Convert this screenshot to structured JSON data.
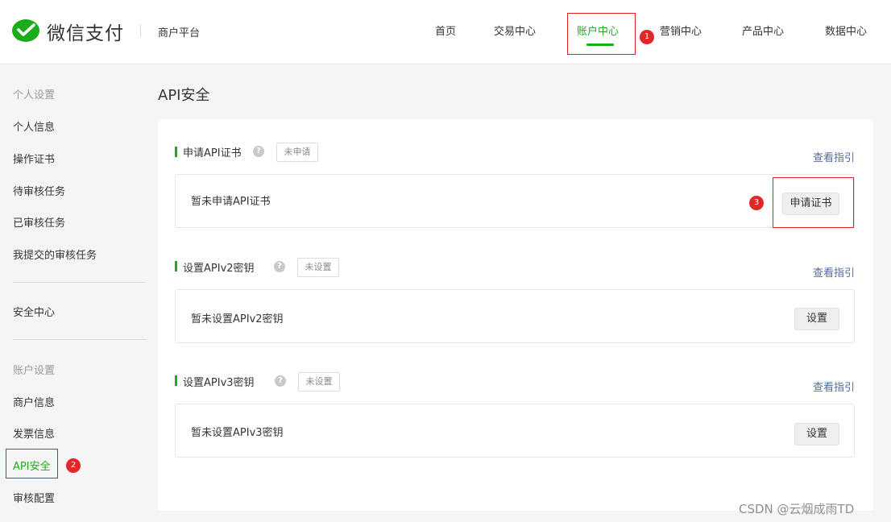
{
  "header": {
    "brand_name": "微信支付",
    "platform_name": "商户平台",
    "nav": [
      {
        "label": "首页"
      },
      {
        "label": "交易中心"
      },
      {
        "label": "账户中心",
        "active": true
      },
      {
        "label": "营销中心"
      },
      {
        "label": "产品中心"
      },
      {
        "label": "数据中心"
      }
    ]
  },
  "sidebar": {
    "group_personal": "个人设置",
    "personal_items": [
      "个人信息",
      "操作证书",
      "待审核任务",
      "已审核任务",
      "我提交的审核任务"
    ],
    "security_center": "安全中心",
    "group_account": "账户设置",
    "account_items": [
      "商户信息",
      "发票信息",
      "API安全",
      "审核配置"
    ],
    "active_item": "API安全"
  },
  "main": {
    "title": "API安全",
    "sections": [
      {
        "title": "申请API证书",
        "status": "未申请",
        "guide": "查看指引",
        "message": "暂未申请API证书",
        "button": "申请证书"
      },
      {
        "title": "设置APIv2密钥",
        "status": "未设置",
        "guide": "查看指引",
        "message": "暂未设置APIv2密钥",
        "button": "设置"
      },
      {
        "title": "设置APIv3密钥",
        "status": "未设置",
        "guide": "查看指引",
        "message": "暂未设置APIv3密钥",
        "button": "设置"
      }
    ]
  },
  "annotations": {
    "badge1": "1",
    "badge2": "2",
    "badge3": "3"
  },
  "icons": {
    "help": "?"
  },
  "watermark": "CSDN @云烟成雨TD",
  "colors": {
    "accent": "#1aad19",
    "link": "#576b95",
    "highlight": "#e02020"
  }
}
